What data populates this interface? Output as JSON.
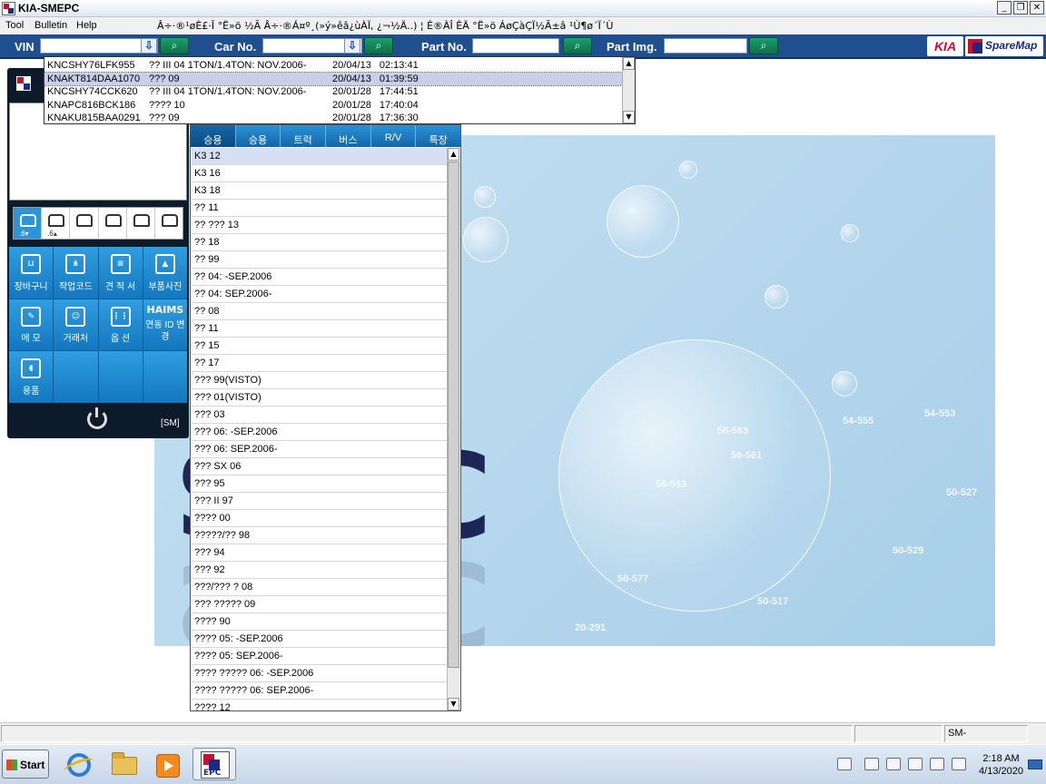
{
  "window": {
    "title": "KIA-SMEPC",
    "minimize": "_",
    "restore": "❐",
    "close": "✕"
  },
  "menu": {
    "tool": "Tool",
    "bulletin": "Bulletin",
    "help": "Help",
    "garbled_notice": "Â÷·®¹øÈ£·Î °Ë»ö ½Ã Â÷·®Á¤º¸(»ý»êâ¿ùÀÏ, ¿¬½Ä..) ¦ È®ÀÎ ÈÄ °Ë»ö ÁøÇàÇÏ½Ã±â ¹Ù¶ø´Ï´Ù"
  },
  "search": {
    "vin_label": "VIN",
    "vin_value": "",
    "car_no_label": "Car No.",
    "car_no_value": "",
    "part_no_label": "Part No.",
    "part_no_value": "",
    "part_img_label": "Part Img.",
    "part_img_value": "",
    "search_icon": "magnifier-icon",
    "dropdown_icon": "arrow-down-icon",
    "logo_kia": "KIA",
    "logo_sparemap": "SpareMap"
  },
  "vin_history": [
    {
      "vin": "KNCSHY76LFK955",
      "model": "?? III 04 1TON/1.4TON: NOV.2006-",
      "date": "20/04/13",
      "time": "02:13:41"
    },
    {
      "vin": "KNAKT814DAA1070",
      "model": "??? 09",
      "date": "20/04/13",
      "time": "01:39:59"
    },
    {
      "vin": "KNCSHY74CCK620",
      "model": "?? III 04 1TON/1.4TON: NOV.2006-",
      "date": "20/01/28",
      "time": "17:44:51"
    },
    {
      "vin": "KNAPC816BCK186",
      "model": "???? 10",
      "date": "20/01/28",
      "time": "17:40:04"
    },
    {
      "vin": "KNAKU815BAA0291",
      "model": "??? 09",
      "date": "20/01/28",
      "time": "17:36:30"
    }
  ],
  "left_panel": {
    "vehicle_types": [
      {
        "icon": "sedan-icon",
        "count": ".6▾"
      },
      {
        "icon": "suv-icon",
        "count": ".6▴"
      },
      {
        "icon": "truck-icon",
        "count": ""
      },
      {
        "icon": "bus-icon",
        "count": ""
      },
      {
        "icon": "rv-icon",
        "count": ""
      },
      {
        "icon": "special-vehicle-icon",
        "count": ""
      }
    ],
    "tiles": {
      "cart": "장바구니",
      "work_code": "작업코드",
      "estimate": "견 적 서",
      "part_photo": "부품사진",
      "memo": "메 모",
      "customer": "거래처",
      "option": "옵 션",
      "haims": "HAIMS",
      "haims_sub": "연동 ID 변경",
      "supplies": "용품"
    },
    "sm_tag": "[SM]"
  },
  "models_panel": {
    "tabs": [
      "승용",
      "승용",
      "트럭",
      "버스",
      "R/V",
      "특장"
    ],
    "items": [
      "K3 12",
      "K3 16",
      "K3 18",
      "?? 11",
      "?? ??? 13",
      "?? 18",
      "?? 99",
      "?? 04: -SEP.2006",
      "?? 04: SEP.2006-",
      "?? 08",
      "?? 11",
      "?? 15",
      "?? 17",
      "??? 99(VISTO)",
      "??? 01(VISTO)",
      "??? 03",
      "??? 06: -SEP.2006",
      "??? 06: SEP.2006-",
      "??? SX 06",
      "??? 95",
      "??? II 97",
      "???? 00",
      "?????/?? 98",
      "??? 94",
      "??? 92",
      "???/??? ? 08",
      "??? ????? 09",
      "???? 90",
      "???? 05: -SEP.2006",
      "???? 05: SEP.2006-",
      "???? ????? 06: -SEP.2006",
      "???? ????? 06: SEP.2006-",
      "???? 12"
    ]
  },
  "background": {
    "labels": [
      "58-583",
      "54-555",
      "54-553",
      "56-561",
      "56-563",
      "50-527",
      "50-529",
      "58-577",
      "50-517",
      "20-291"
    ]
  },
  "statusbar": {
    "cell3": "SM-"
  },
  "taskbar": {
    "start": "Start",
    "apps": [
      "internet-explorer-icon",
      "file-explorer-icon",
      "media-player-icon",
      "epc-app-icon"
    ],
    "epc_label": "EPC",
    "time": "2:18 AM",
    "date": "4/13/2020"
  }
}
